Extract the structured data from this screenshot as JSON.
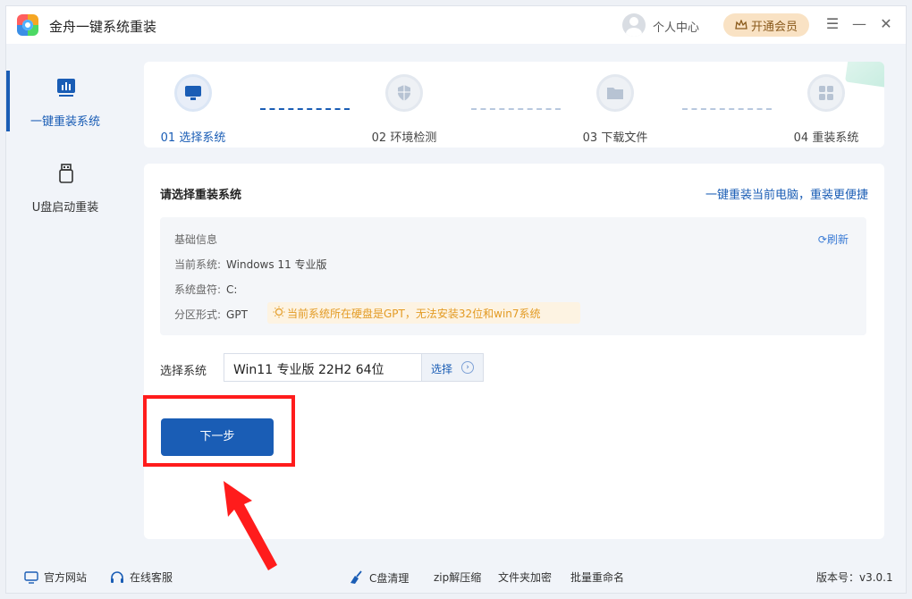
{
  "titlebar": {
    "app_title": "金舟一键系统重装",
    "user_center": "个人中心",
    "vip": "开通会员",
    "menu_glyph": "☰",
    "minimize_glyph": "—",
    "close_glyph": "✕"
  },
  "sidebar": {
    "items": [
      {
        "label": "一键重装系统",
        "icon": "chart-monitor-icon",
        "active": true
      },
      {
        "label": "U盘启动重装",
        "icon": "usb-drive-icon",
        "active": false
      }
    ]
  },
  "stepper": {
    "steps": [
      {
        "label": "01 选择系统",
        "icon": "monitor-icon",
        "active": true
      },
      {
        "label": "02 环境检测",
        "icon": "shield-icon",
        "active": false
      },
      {
        "label": "03 下载文件",
        "icon": "folder-icon",
        "active": false
      },
      {
        "label": "04 重装系统",
        "icon": "windows-grid-icon",
        "active": false
      }
    ]
  },
  "panel": {
    "title": "请选择重装系统",
    "link": "一键重装当前电脑，重装更便捷",
    "info": {
      "heading": "基础信息",
      "refresh": "刷新",
      "current_system_label": "当前系统:",
      "current_system_value": "Windows 11 专业版",
      "drive_label": "系统盘符:",
      "drive_value": "C:",
      "partition_label": "分区形式:",
      "partition_value": "GPT",
      "warning": "当前系统所在硬盘是GPT，无法安装32位和win7系统"
    },
    "select_label": "选择系统",
    "select_value": "Win11 专业版 22H2 64位",
    "select_button": "选择",
    "next_button": "下一步"
  },
  "footer": {
    "website": "官方网站",
    "support": "在线客服",
    "clean": "C盘清理",
    "zip": "zip解压缩",
    "encrypt": "文件夹加密",
    "rename": "批量重命名",
    "version": "版本号：v3.0.1"
  },
  "colors": {
    "accent": "#1a5db5",
    "warning": "#e39b24",
    "highlight": "#ff1c1c"
  }
}
